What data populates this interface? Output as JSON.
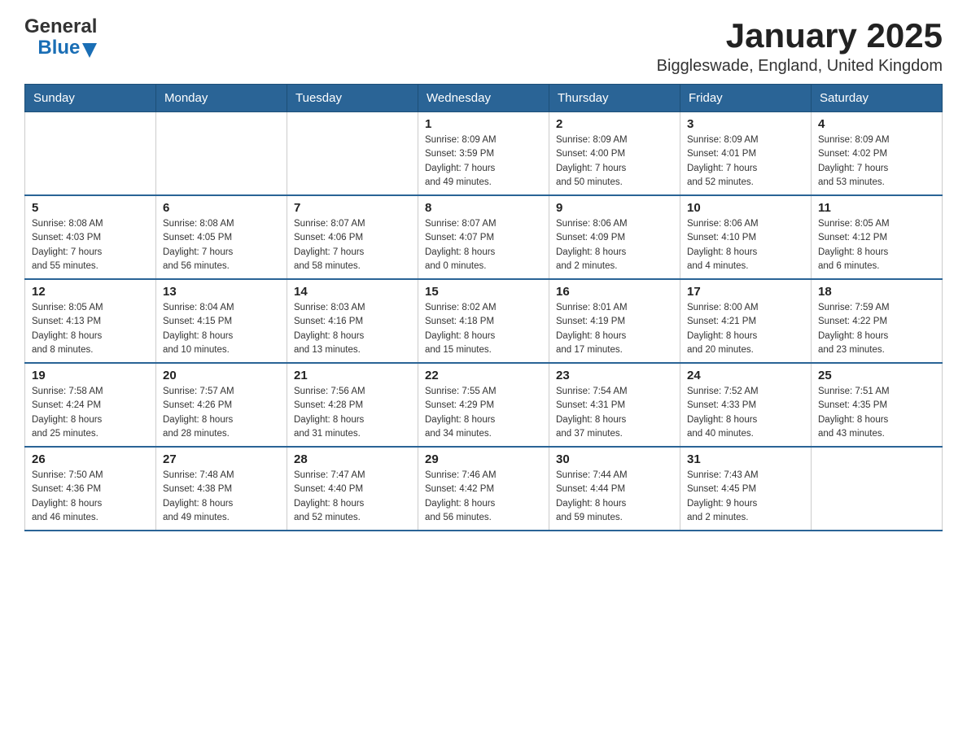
{
  "logo": {
    "general": "General",
    "blue": "Blue"
  },
  "title": "January 2025",
  "location": "Biggleswade, England, United Kingdom",
  "days_of_week": [
    "Sunday",
    "Monday",
    "Tuesday",
    "Wednesday",
    "Thursday",
    "Friday",
    "Saturday"
  ],
  "weeks": [
    [
      {
        "day": "",
        "info": ""
      },
      {
        "day": "",
        "info": ""
      },
      {
        "day": "",
        "info": ""
      },
      {
        "day": "1",
        "info": "Sunrise: 8:09 AM\nSunset: 3:59 PM\nDaylight: 7 hours\nand 49 minutes."
      },
      {
        "day": "2",
        "info": "Sunrise: 8:09 AM\nSunset: 4:00 PM\nDaylight: 7 hours\nand 50 minutes."
      },
      {
        "day": "3",
        "info": "Sunrise: 8:09 AM\nSunset: 4:01 PM\nDaylight: 7 hours\nand 52 minutes."
      },
      {
        "day": "4",
        "info": "Sunrise: 8:09 AM\nSunset: 4:02 PM\nDaylight: 7 hours\nand 53 minutes."
      }
    ],
    [
      {
        "day": "5",
        "info": "Sunrise: 8:08 AM\nSunset: 4:03 PM\nDaylight: 7 hours\nand 55 minutes."
      },
      {
        "day": "6",
        "info": "Sunrise: 8:08 AM\nSunset: 4:05 PM\nDaylight: 7 hours\nand 56 minutes."
      },
      {
        "day": "7",
        "info": "Sunrise: 8:07 AM\nSunset: 4:06 PM\nDaylight: 7 hours\nand 58 minutes."
      },
      {
        "day": "8",
        "info": "Sunrise: 8:07 AM\nSunset: 4:07 PM\nDaylight: 8 hours\nand 0 minutes."
      },
      {
        "day": "9",
        "info": "Sunrise: 8:06 AM\nSunset: 4:09 PM\nDaylight: 8 hours\nand 2 minutes."
      },
      {
        "day": "10",
        "info": "Sunrise: 8:06 AM\nSunset: 4:10 PM\nDaylight: 8 hours\nand 4 minutes."
      },
      {
        "day": "11",
        "info": "Sunrise: 8:05 AM\nSunset: 4:12 PM\nDaylight: 8 hours\nand 6 minutes."
      }
    ],
    [
      {
        "day": "12",
        "info": "Sunrise: 8:05 AM\nSunset: 4:13 PM\nDaylight: 8 hours\nand 8 minutes."
      },
      {
        "day": "13",
        "info": "Sunrise: 8:04 AM\nSunset: 4:15 PM\nDaylight: 8 hours\nand 10 minutes."
      },
      {
        "day": "14",
        "info": "Sunrise: 8:03 AM\nSunset: 4:16 PM\nDaylight: 8 hours\nand 13 minutes."
      },
      {
        "day": "15",
        "info": "Sunrise: 8:02 AM\nSunset: 4:18 PM\nDaylight: 8 hours\nand 15 minutes."
      },
      {
        "day": "16",
        "info": "Sunrise: 8:01 AM\nSunset: 4:19 PM\nDaylight: 8 hours\nand 17 minutes."
      },
      {
        "day": "17",
        "info": "Sunrise: 8:00 AM\nSunset: 4:21 PM\nDaylight: 8 hours\nand 20 minutes."
      },
      {
        "day": "18",
        "info": "Sunrise: 7:59 AM\nSunset: 4:22 PM\nDaylight: 8 hours\nand 23 minutes."
      }
    ],
    [
      {
        "day": "19",
        "info": "Sunrise: 7:58 AM\nSunset: 4:24 PM\nDaylight: 8 hours\nand 25 minutes."
      },
      {
        "day": "20",
        "info": "Sunrise: 7:57 AM\nSunset: 4:26 PM\nDaylight: 8 hours\nand 28 minutes."
      },
      {
        "day": "21",
        "info": "Sunrise: 7:56 AM\nSunset: 4:28 PM\nDaylight: 8 hours\nand 31 minutes."
      },
      {
        "day": "22",
        "info": "Sunrise: 7:55 AM\nSunset: 4:29 PM\nDaylight: 8 hours\nand 34 minutes."
      },
      {
        "day": "23",
        "info": "Sunrise: 7:54 AM\nSunset: 4:31 PM\nDaylight: 8 hours\nand 37 minutes."
      },
      {
        "day": "24",
        "info": "Sunrise: 7:52 AM\nSunset: 4:33 PM\nDaylight: 8 hours\nand 40 minutes."
      },
      {
        "day": "25",
        "info": "Sunrise: 7:51 AM\nSunset: 4:35 PM\nDaylight: 8 hours\nand 43 minutes."
      }
    ],
    [
      {
        "day": "26",
        "info": "Sunrise: 7:50 AM\nSunset: 4:36 PM\nDaylight: 8 hours\nand 46 minutes."
      },
      {
        "day": "27",
        "info": "Sunrise: 7:48 AM\nSunset: 4:38 PM\nDaylight: 8 hours\nand 49 minutes."
      },
      {
        "day": "28",
        "info": "Sunrise: 7:47 AM\nSunset: 4:40 PM\nDaylight: 8 hours\nand 52 minutes."
      },
      {
        "day": "29",
        "info": "Sunrise: 7:46 AM\nSunset: 4:42 PM\nDaylight: 8 hours\nand 56 minutes."
      },
      {
        "day": "30",
        "info": "Sunrise: 7:44 AM\nSunset: 4:44 PM\nDaylight: 8 hours\nand 59 minutes."
      },
      {
        "day": "31",
        "info": "Sunrise: 7:43 AM\nSunset: 4:45 PM\nDaylight: 9 hours\nand 2 minutes."
      },
      {
        "day": "",
        "info": ""
      }
    ]
  ]
}
